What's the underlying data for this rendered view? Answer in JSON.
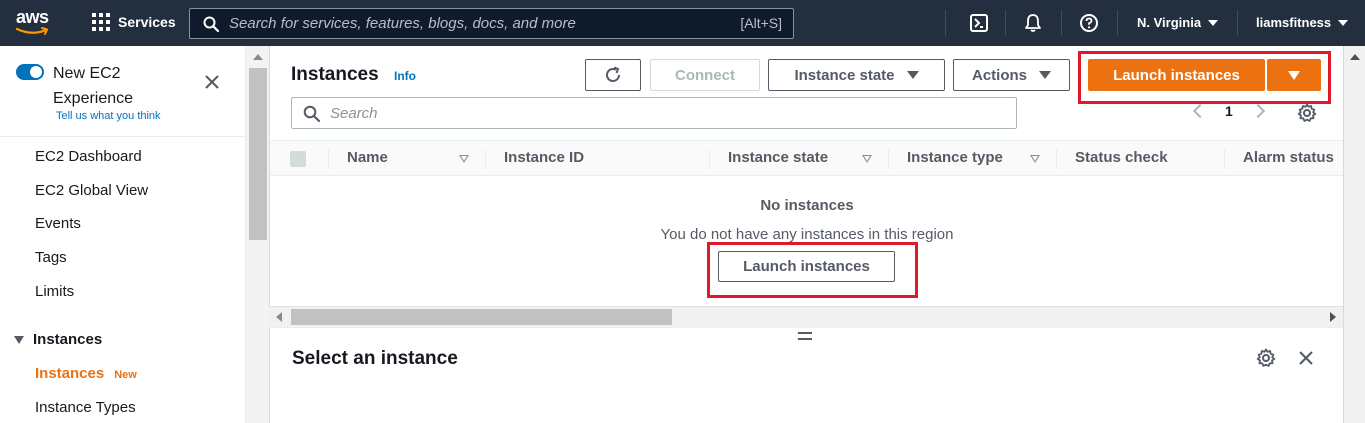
{
  "topnav": {
    "logo_text": "aws",
    "services_label": "Services",
    "search_placeholder": "Search for services, features, blogs, docs, and more",
    "search_shortcut": "[Alt+S]",
    "region": "N. Virginia",
    "account": "liamsfitness",
    "icons": [
      "cloudshell-icon",
      "bell-icon",
      "help-icon"
    ]
  },
  "sidebar": {
    "toggle_label": "New EC2 Experience",
    "feedback_link": "Tell us what you think",
    "links": [
      "EC2 Dashboard",
      "EC2 Global View",
      "Events",
      "Tags",
      "Limits"
    ],
    "section": "Instances",
    "active_item": "Instances",
    "active_badge": "New",
    "next_item": "Instance Types"
  },
  "instances_panel": {
    "title": "Instances",
    "info": "Info",
    "connect_label": "Connect",
    "instance_state_label": "Instance state",
    "actions_label": "Actions",
    "launch_label": "Launch instances",
    "filter_placeholder": "Search",
    "page_number": "1",
    "columns": [
      "Name",
      "Instance ID",
      "Instance state",
      "Instance type",
      "Status check",
      "Alarm status"
    ],
    "empty_title": "No instances",
    "empty_description": "You do not have any instances in this region",
    "empty_launch_label": "Launch instances"
  },
  "detail_panel": {
    "title": "Select an instance"
  },
  "colors": {
    "nav_bg": "#232f3e",
    "primary": "#ec7211",
    "link": "#0073bb",
    "highlight": "#e0192a"
  }
}
